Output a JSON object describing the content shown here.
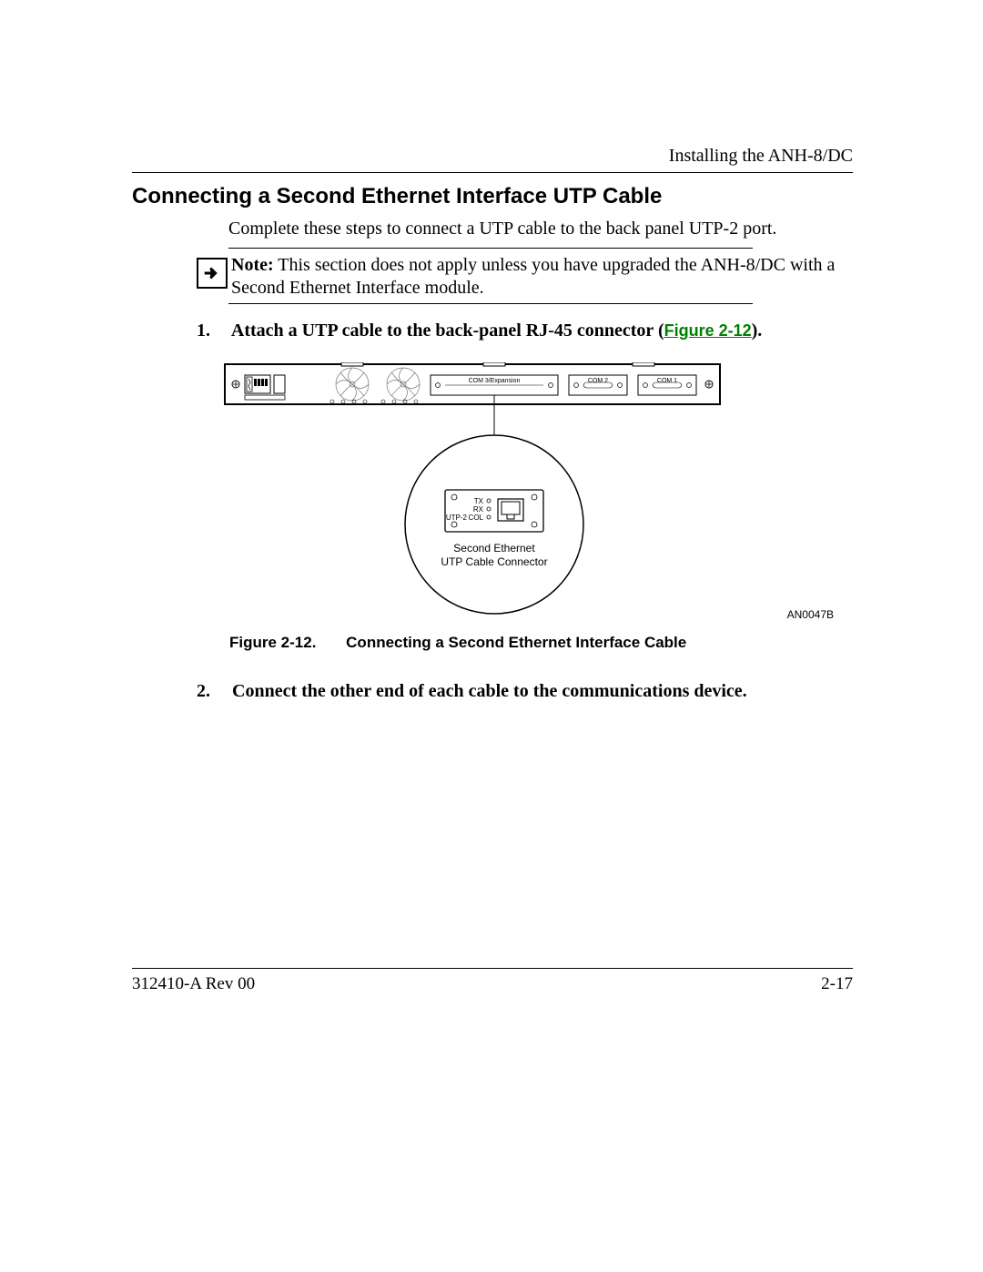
{
  "header": {
    "chapter": "Installing the ANH-8/DC"
  },
  "section": {
    "title": "Connecting a Second Ethernet Interface UTP Cable"
  },
  "intro": "Complete these steps to connect a UTP cable to the back panel UTP-2 port.",
  "note": {
    "label": "Note:",
    "text": "This section does not apply unless you have upgraded the ANH-8/DC with a Second Ethernet Interface module."
  },
  "steps": {
    "s1": {
      "num": "1.",
      "text": "Attach a UTP cable to the back-panel RJ-45 connector (",
      "ref": "Figure 2-12",
      "tail": ")."
    },
    "s2": {
      "num": "2.",
      "text": "Connect the other end of each cable to the communications device."
    }
  },
  "figure": {
    "code": "AN0047B",
    "caption_lead": "Figure 2-12.",
    "caption": "Connecting a Second Ethernet Interface Cable",
    "panel": {
      "com3": "COM 3/Expansion",
      "com2": "COM 2",
      "com1": "COM 1"
    },
    "utp": {
      "tx": "TX",
      "rx": "RX",
      "utp2": "UTP-2",
      "col": "COL",
      "callout1": "Second Ethernet",
      "callout2": "UTP Cable Connector"
    }
  },
  "footer": {
    "doc": "312410-A Rev 00",
    "page": "2-17"
  }
}
